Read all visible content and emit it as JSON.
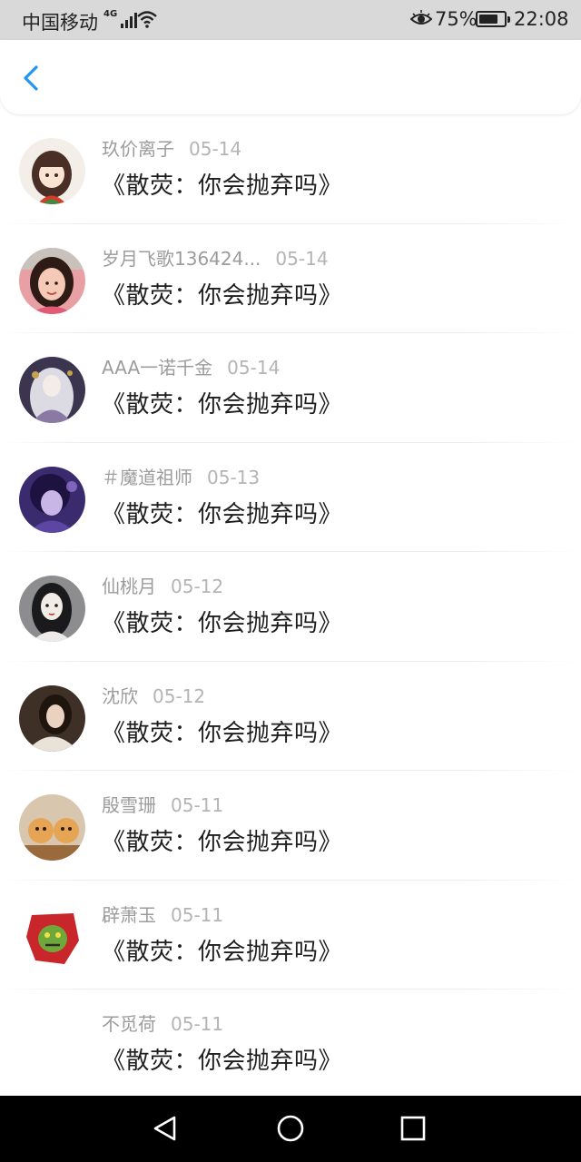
{
  "status_bar": {
    "carrier": "中国移动",
    "network": "4G",
    "battery_percent": "75%",
    "time": "22:08",
    "icons": [
      "signal-icon",
      "wifi-icon",
      "eye-comfort-icon",
      "battery-icon"
    ]
  },
  "header": {
    "back_icon": "chevron-left-icon",
    "accent_color": "#2196f3"
  },
  "comments": [
    {
      "user": "玖价离子",
      "date": "05-14",
      "title": "《散荧：你会抛弃吗》"
    },
    {
      "user": "岁月飞歌136424...",
      "date": "05-14",
      "title": "《散荧：你会抛弃吗》"
    },
    {
      "user": "AAA一诺千金",
      "date": "05-14",
      "title": "《散荧：你会抛弃吗》"
    },
    {
      "user": "＃魔道祖师",
      "date": "05-13",
      "title": "《散荧：你会抛弃吗》"
    },
    {
      "user": "仙桃月",
      "date": "05-12",
      "title": "《散荧：你会抛弃吗》"
    },
    {
      "user": "沈欣",
      "date": "05-12",
      "title": "《散荧：你会抛弃吗》"
    },
    {
      "user": "殷雪珊",
      "date": "05-11",
      "title": "《散荧：你会抛弃吗》"
    },
    {
      "user": "辟萧玉",
      "date": "05-11",
      "title": "《散荧：你会抛弃吗》"
    },
    {
      "user": "不觅荷",
      "date": "05-11",
      "title": "《散荧：你会抛弃吗》"
    }
  ],
  "system_nav": [
    "back-triangle-icon",
    "home-circle-icon",
    "recents-square-icon"
  ]
}
